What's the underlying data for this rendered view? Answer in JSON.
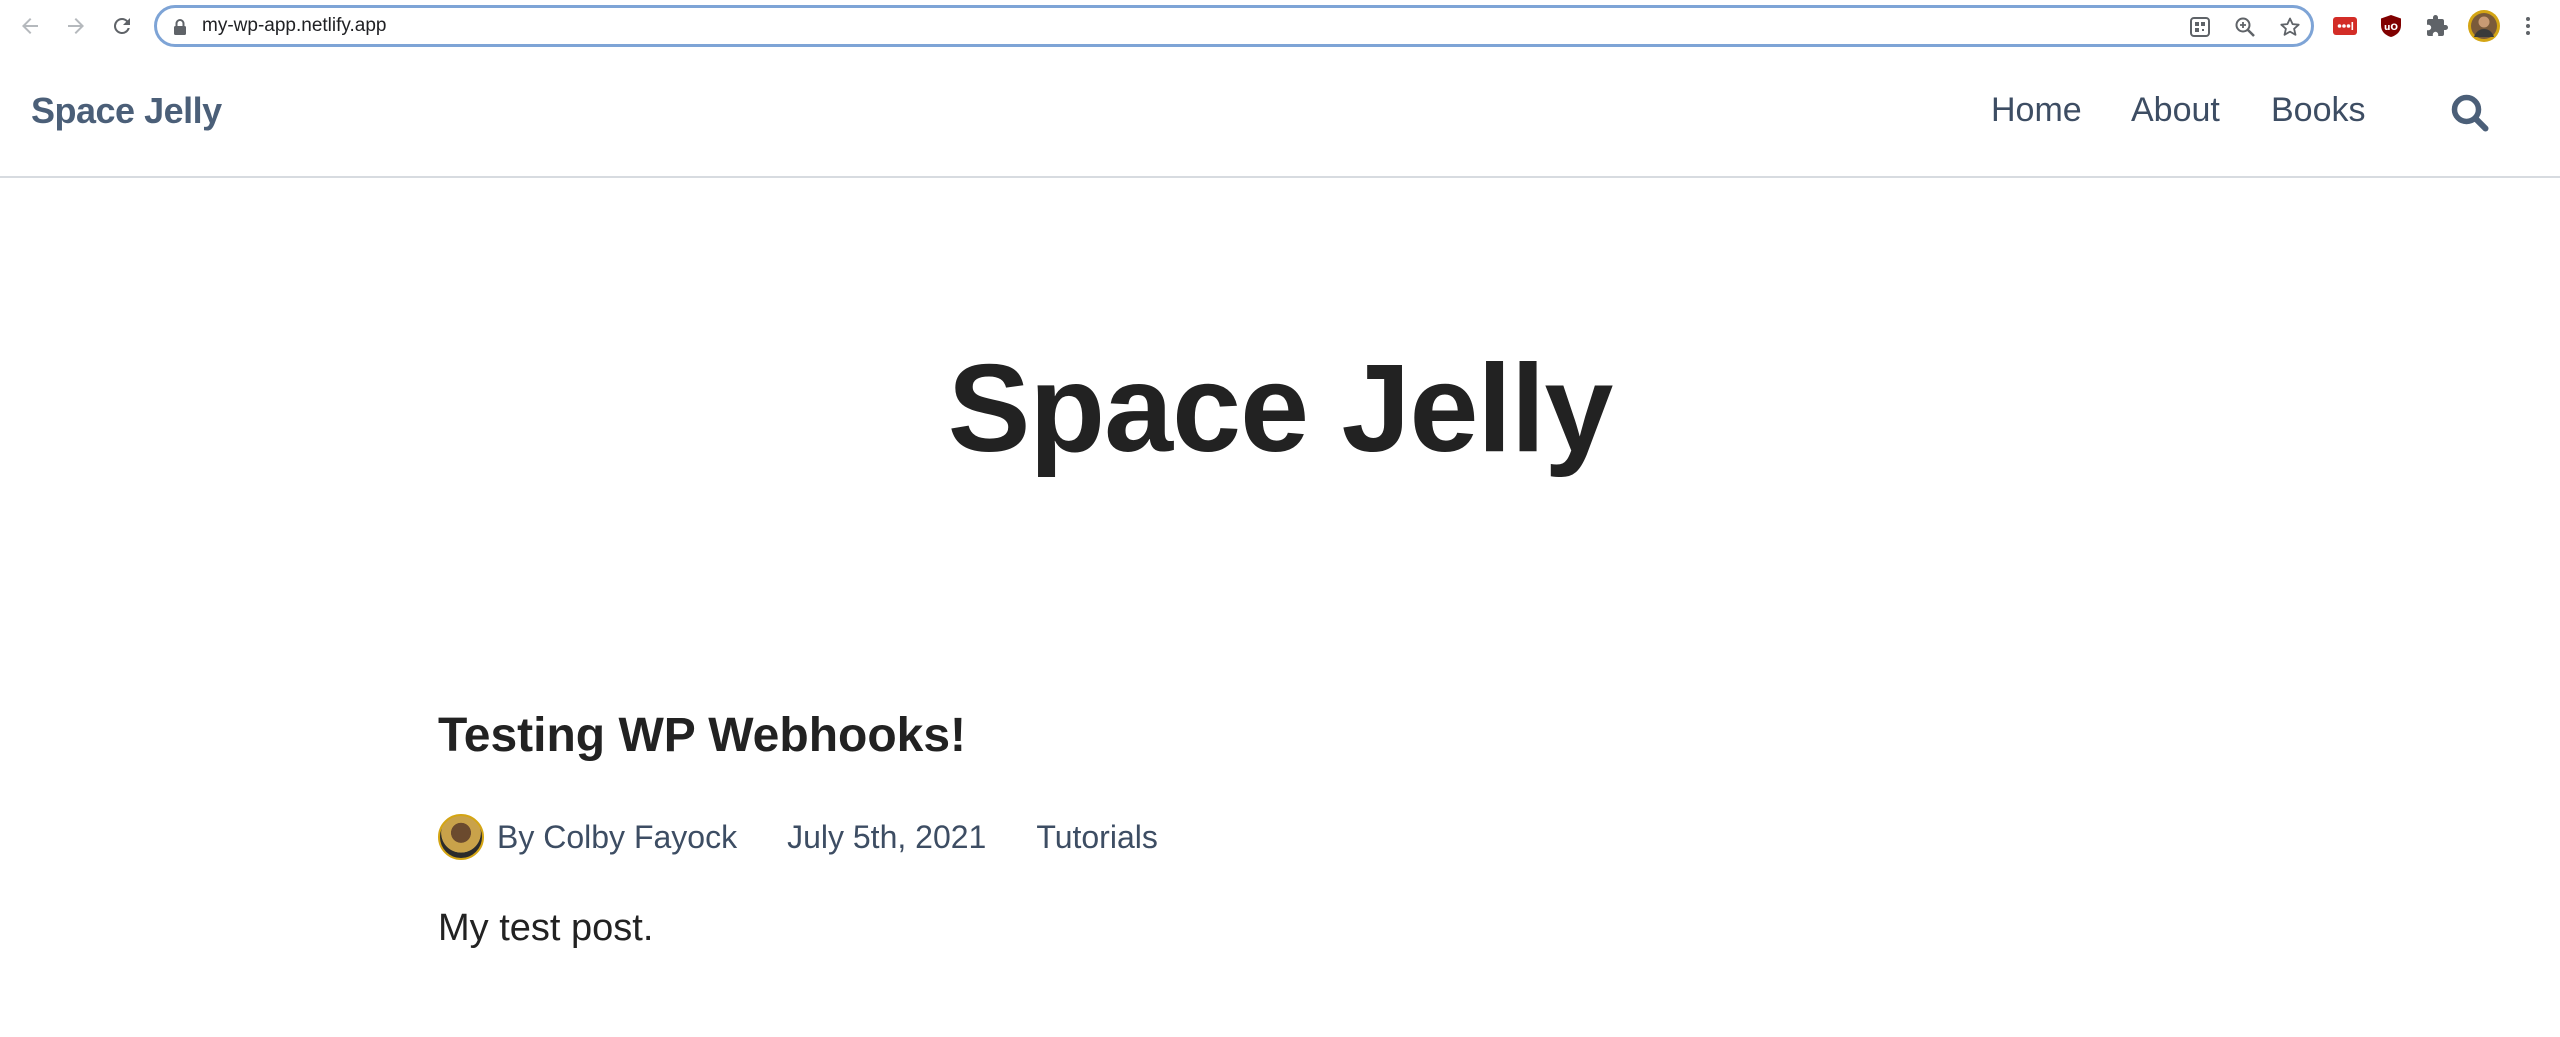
{
  "browser": {
    "url": "my-wp-app.netlify.app",
    "icons": [
      "back-arrow-icon",
      "forward-arrow-icon",
      "reload-icon",
      "lock-icon",
      "qr-code-icon",
      "zoom-icon",
      "bookmark-star-icon",
      "extension-lastpass-icon",
      "extension-ublock-icon",
      "extensions-puzzle-icon",
      "profile-avatar-icon",
      "menu-dots-icon"
    ],
    "colors": {
      "omnibox_border": "#7ea4d6",
      "lastpass_red": "#d32d27",
      "ublock_red": "#800000"
    }
  },
  "header": {
    "brand": "Space Jelly",
    "nav": [
      {
        "label": "Home"
      },
      {
        "label": "About"
      },
      {
        "label": "Books"
      }
    ],
    "search_icon": "search-icon",
    "colors": {
      "brand": "#4b5f78",
      "nav": "#3d4d63"
    }
  },
  "hero": {
    "title": "Space Jelly"
  },
  "post": {
    "title": "Testing WP Webhooks!",
    "author": "By Colby Fayock",
    "date": "July 5th, 2021",
    "category": "Tutorials",
    "excerpt": "My test post."
  }
}
